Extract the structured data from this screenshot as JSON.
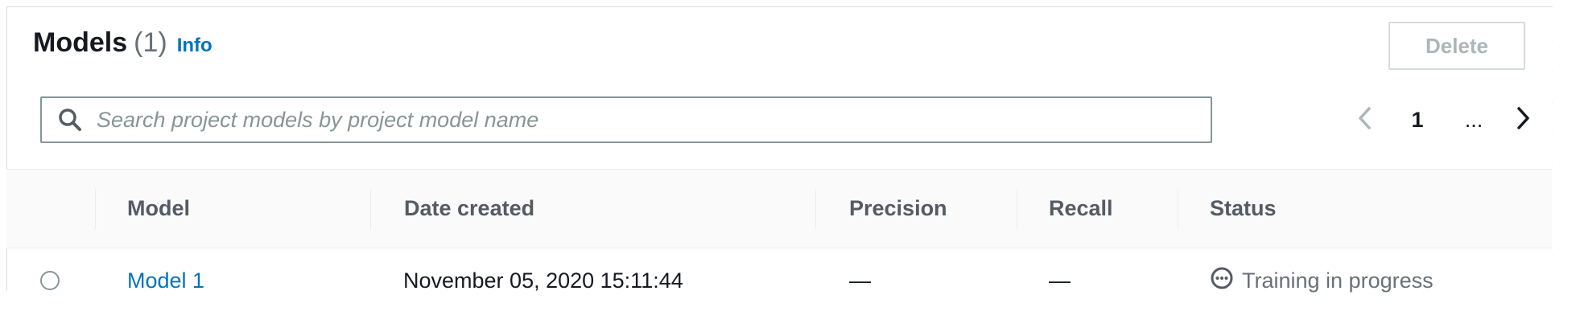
{
  "header": {
    "title": "Models",
    "count": "(1)",
    "info_label": "Info",
    "delete_label": "Delete"
  },
  "search": {
    "placeholder": "Search project models by project model name",
    "value": ""
  },
  "pagination": {
    "current_page": "1",
    "ellipsis": "..."
  },
  "table": {
    "columns": [
      "Model",
      "Date created",
      "Precision",
      "Recall",
      "Status"
    ],
    "rows": [
      {
        "model": "Model 1",
        "date_created": "November 05, 2020 15:11:44",
        "precision": "—",
        "recall": "—",
        "status": "Training in progress",
        "status_icon": "in-progress-icon",
        "selected": false
      }
    ]
  },
  "colors": {
    "link": "#0073bb",
    "title": "#16191f",
    "muted": "#687078",
    "disabled": "#aab7b8",
    "header_bg": "#fafafa",
    "border": "#d5dbdb"
  }
}
